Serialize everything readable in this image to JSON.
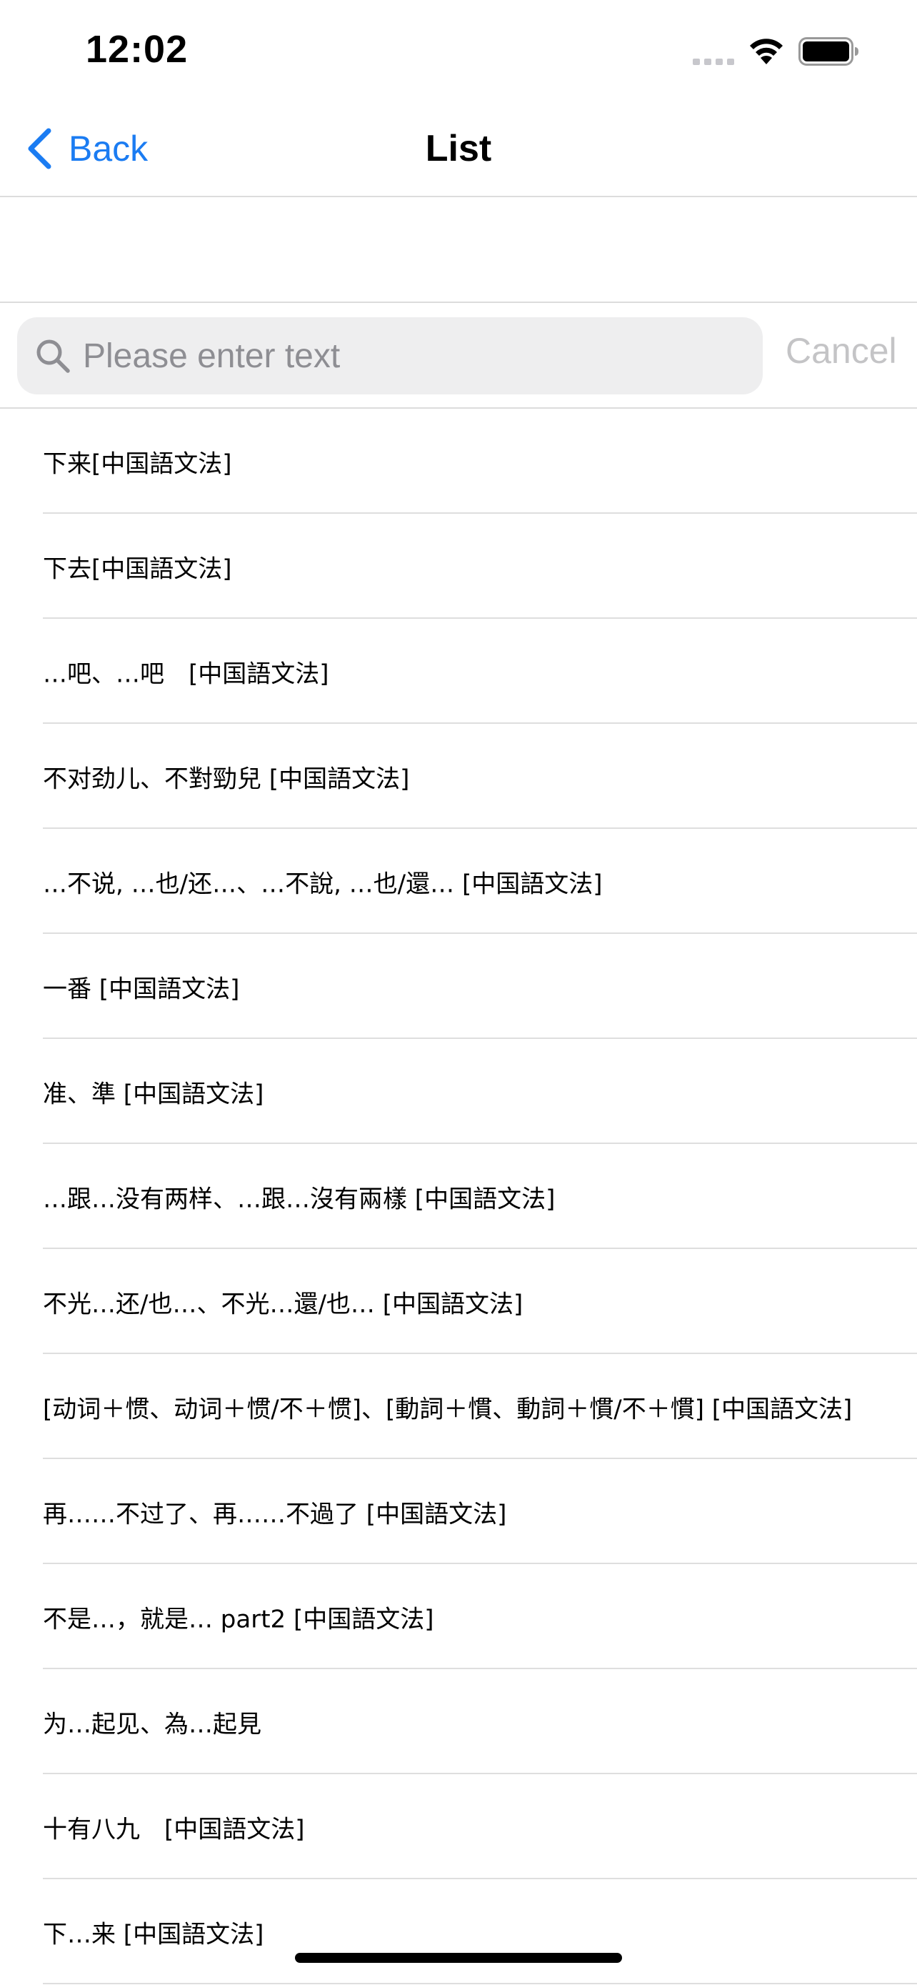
{
  "status_bar": {
    "time": "12:02"
  },
  "nav": {
    "back_label": "Back",
    "title": "List"
  },
  "search": {
    "placeholder": "Please enter text",
    "value": "",
    "cancel_label": "Cancel"
  },
  "list": {
    "items": [
      {
        "label": "下来[中国語文法]"
      },
      {
        "label": "下去[中国語文法]"
      },
      {
        "label": "…吧、…吧　[中国語文法]"
      },
      {
        "label": "不对劲儿、不對勁兒 [中国語文法]"
      },
      {
        "label": "…不说, …也/还…、…不說, …也/還… [中国語文法]"
      },
      {
        "label": "一番 [中国語文法]"
      },
      {
        "label": "准、準 [中国語文法]"
      },
      {
        "label": "…跟…没有两样、…跟…沒有兩樣 [中国語文法]"
      },
      {
        "label": "不光…还/也…、不光…還/也… [中国語文法]"
      },
      {
        "label": "[动词＋惯、动词＋惯/不＋惯]、[動詞＋慣、動詞＋慣/不＋慣] [中国語文法]"
      },
      {
        "label": "再……不过了、再……不過了 [中国語文法]"
      },
      {
        "label": "不是…，就是… part2 [中国語文法]"
      },
      {
        "label": "为…起见、為…起見"
      },
      {
        "label": "十有八九　[中国語文法]"
      },
      {
        "label": "下…来 [中国語文法]"
      }
    ]
  },
  "colors": {
    "accent": "#1b7cf2",
    "cancel_disabled": "#c4c4c6",
    "search_bg": "#eeeeef",
    "separator": "#dedede"
  }
}
